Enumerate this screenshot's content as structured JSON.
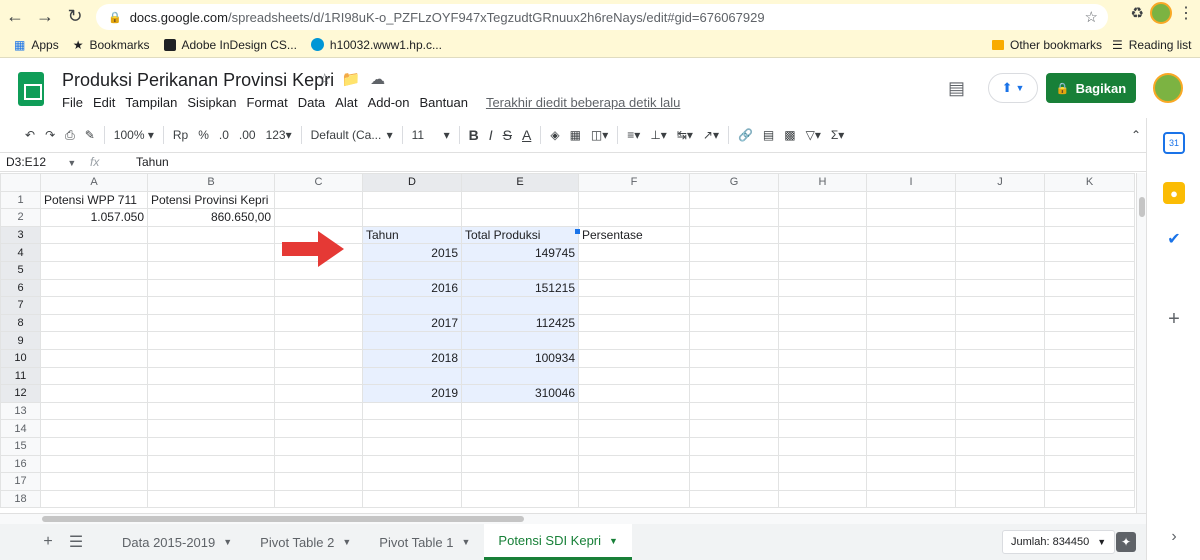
{
  "browser": {
    "url_host": "docs.google.com",
    "url_path": "/spreadsheets/d/1RI98uK-o_PZFLzOYF947xTegzudtGRnuux2h6reNays/edit#gid=676067929",
    "bookmarks": [
      "Apps",
      "Bookmarks",
      "Adobe InDesign CS...",
      "h10032.www1.hp.c..."
    ],
    "other_bookmarks": "Other bookmarks",
    "reading_list": "Reading list"
  },
  "doc": {
    "title": "Produksi Perikanan Provinsi Kepri",
    "menu": [
      "File",
      "Edit",
      "Tampilan",
      "Sisipkan",
      "Format",
      "Data",
      "Alat",
      "Add-on",
      "Bantuan"
    ],
    "last_edit": "Terakhir diedit beberapa detik lalu",
    "share_label": "Bagikan"
  },
  "toolbar": {
    "zoom": "100%",
    "currency": "Rp",
    "percent": "%",
    "dec_less": ".0",
    "dec_more": ".00",
    "format_more": "123",
    "font": "Default (Ca...",
    "font_size": "11",
    "bold": "B",
    "italic": "I",
    "strike": "S",
    "text_color": "A"
  },
  "formula_bar": {
    "name_box": "D3:E12",
    "fx": "fx",
    "content": "Tahun"
  },
  "sheet": {
    "columns": [
      "A",
      "B",
      "C",
      "D",
      "E",
      "F",
      "G",
      "H",
      "I",
      "J",
      "K"
    ],
    "rows": [
      [
        "Potensi WPP 711",
        "Potensi Provinsi Kepri",
        "",
        "",
        "",
        "",
        "",
        "",
        "",
        "",
        ""
      ],
      [
        "1.057.050",
        "860.650,00",
        "",
        "",
        "",
        "",
        "",
        "",
        "",
        "",
        ""
      ],
      [
        "",
        "",
        "",
        "Tahun",
        "Total Produksi",
        "Persentase",
        "",
        "",
        "",
        "",
        ""
      ],
      [
        "",
        "",
        "",
        "2015",
        "149745",
        "",
        "",
        "",
        "",
        "",
        ""
      ],
      [
        "",
        "",
        "",
        "",
        "",
        "",
        "",
        "",
        "",
        "",
        ""
      ],
      [
        "",
        "",
        "",
        "2016",
        "151215",
        "",
        "",
        "",
        "",
        "",
        ""
      ],
      [
        "",
        "",
        "",
        "",
        "",
        "",
        "",
        "",
        "",
        "",
        ""
      ],
      [
        "",
        "",
        "",
        "2017",
        "112425",
        "",
        "",
        "",
        "",
        "",
        ""
      ],
      [
        "",
        "",
        "",
        "",
        "",
        "",
        "",
        "",
        "",
        "",
        ""
      ],
      [
        "",
        "",
        "",
        "2018",
        "100934",
        "",
        "",
        "",
        "",
        "",
        ""
      ],
      [
        "",
        "",
        "",
        "",
        "",
        "",
        "",
        "",
        "",
        "",
        ""
      ],
      [
        "",
        "",
        "",
        "2019",
        "310046",
        "",
        "",
        "",
        "",
        "",
        ""
      ],
      [
        "",
        "",
        "",
        "",
        "",
        "",
        "",
        "",
        "",
        "",
        ""
      ],
      [
        "",
        "",
        "",
        "",
        "",
        "",
        "",
        "",
        "",
        "",
        ""
      ],
      [
        "",
        "",
        "",
        "",
        "",
        "",
        "",
        "",
        "",
        "",
        ""
      ],
      [
        "",
        "",
        "",
        "",
        "",
        "",
        "",
        "",
        "",
        "",
        ""
      ],
      [
        "",
        "",
        "",
        "",
        "",
        "",
        "",
        "",
        "",
        "",
        ""
      ],
      [
        "",
        "",
        "",
        "",
        "",
        "",
        "",
        "",
        "",
        "",
        ""
      ]
    ]
  },
  "tabs": {
    "items": [
      {
        "label": "Data 2015-2019",
        "active": false
      },
      {
        "label": "Pivot Table 2",
        "active": false
      },
      {
        "label": "Pivot Table 1",
        "active": false
      },
      {
        "label": "Potensi SDI Kepri",
        "active": true
      }
    ],
    "sum": "Jumlah: 834450"
  },
  "colors": {
    "accent": "#1a73e8",
    "share_green": "#188038",
    "selection_fill": "#e8f0fe",
    "arrow_red": "#e53935"
  }
}
